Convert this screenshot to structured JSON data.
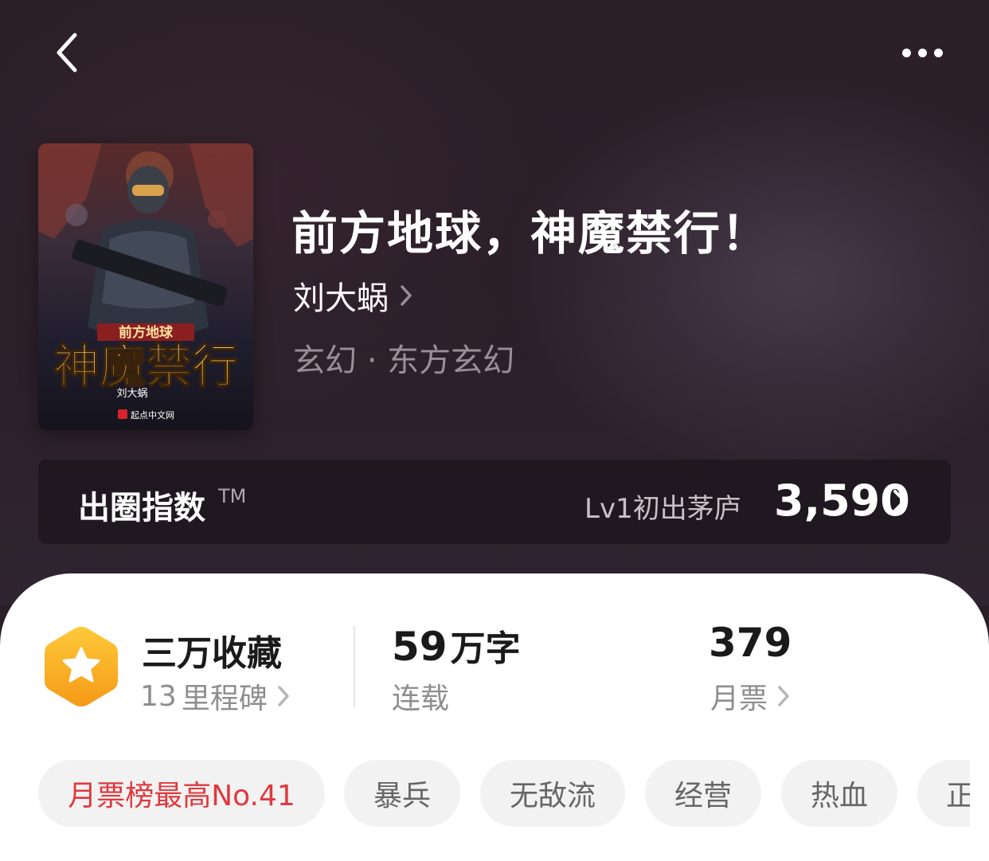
{
  "book": {
    "title": "前方地球，神魔禁行！",
    "author": "刘大蜗",
    "genre": "玄幻 · 东方玄幻",
    "cover": {
      "series_label": "前方地球",
      "main_title": "神魔禁行",
      "author": "刘大蜗",
      "publisher": "起点中文网"
    }
  },
  "circle_index": {
    "label": "出圈指数",
    "trademark": "TM",
    "level": "Lv1初出茅庐",
    "value": "3,590"
  },
  "stats": {
    "collections": "三万收藏",
    "milestones_count": "13",
    "milestones_label": "里程碑",
    "word_count_num": "59",
    "word_count_unit": "万字",
    "status": "连载",
    "monthly_votes": "379",
    "monthly_votes_label": "月票"
  },
  "tags": [
    "月票榜最高No.41",
    "暴兵",
    "无敌流",
    "经营",
    "热血",
    "正"
  ],
  "colors": {
    "header_bg": "#2a1e27",
    "tag_highlight": "#e0393e",
    "badge_orange": "#f6a623"
  },
  "icons": {
    "back": "chevron-left-icon",
    "more": "more-dots-icon",
    "badge": "hexagon-star-icon"
  }
}
